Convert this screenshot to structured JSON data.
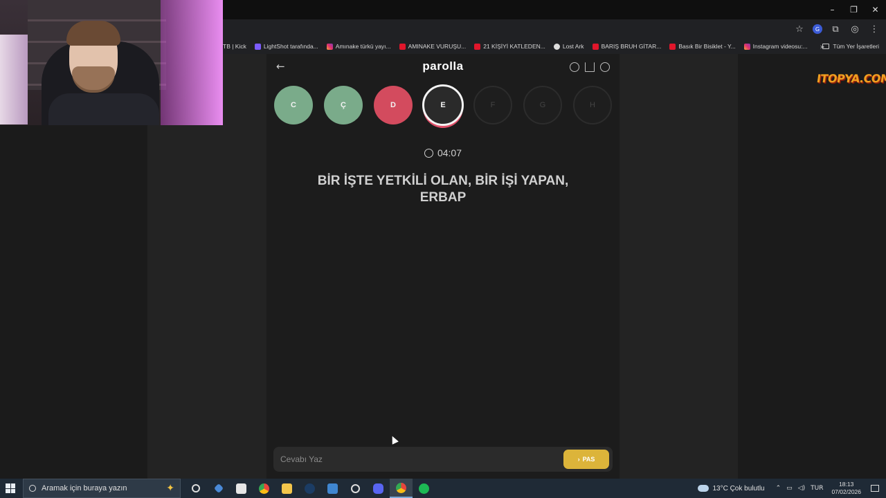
{
  "browser": {
    "window_controls": [
      "–",
      "❐",
      "✕"
    ],
    "bookmarks": [
      {
        "label": "TB | Kick",
        "icon": "kick-icon",
        "color": "none"
      },
      {
        "label": "LightShot tarafında...",
        "icon": "lightshot-icon",
        "color": "lsht"
      },
      {
        "label": "Amınake türkü yayı...",
        "icon": "instagram-icon",
        "color": "ig"
      },
      {
        "label": "AMINAKE VURUŞU...",
        "icon": "youtube-icon",
        "color": "yt"
      },
      {
        "label": "21 KİŞİYİ KATLEDEN...",
        "icon": "youtube-icon",
        "color": "yt"
      },
      {
        "label": "Lost Ark",
        "icon": "lost-ark-icon",
        "color": "lost"
      },
      {
        "label": "BARIŞ BRUH GİTAR...",
        "icon": "youtube-icon",
        "color": "yt"
      },
      {
        "label": "Basık Bir Bisiklet - Y...",
        "icon": "youtube-icon",
        "color": "yt"
      },
      {
        "label": "Instagram videosu:...",
        "icon": "instagram-icon",
        "color": "ig"
      }
    ],
    "bookmarks_more": "»",
    "all_bookmarks": "Tüm Yer İşaretleri"
  },
  "watermark": "ITOPYA.COM",
  "game": {
    "logo": "parolla",
    "letters": [
      {
        "letter": "C",
        "state": "correct"
      },
      {
        "letter": "Ç",
        "state": "correct"
      },
      {
        "letter": "D",
        "state": "wrong"
      },
      {
        "letter": "E",
        "state": "active"
      },
      {
        "letter": "F",
        "state": "pending"
      },
      {
        "letter": "G",
        "state": "pending"
      },
      {
        "letter": "H",
        "state": "pending"
      }
    ],
    "timer": "04:07",
    "question": "BİR İŞTE YETKİLİ OLAN, BİR İŞİ YAPAN, ERBAP",
    "answer_placeholder": "Cevabı Yaz",
    "pass_label": "PAS",
    "pass_chevron": "›",
    "colors": {
      "correct": "#7aab8a",
      "wrong": "#d34b5e",
      "pass": "#dcb43a"
    }
  },
  "taskbar": {
    "search_placeholder": "Aramak için buraya yazın",
    "weather": "13°C  Çok bulutlu",
    "lang": "TUR",
    "time": "18:13",
    "date": "07/02/2026"
  }
}
